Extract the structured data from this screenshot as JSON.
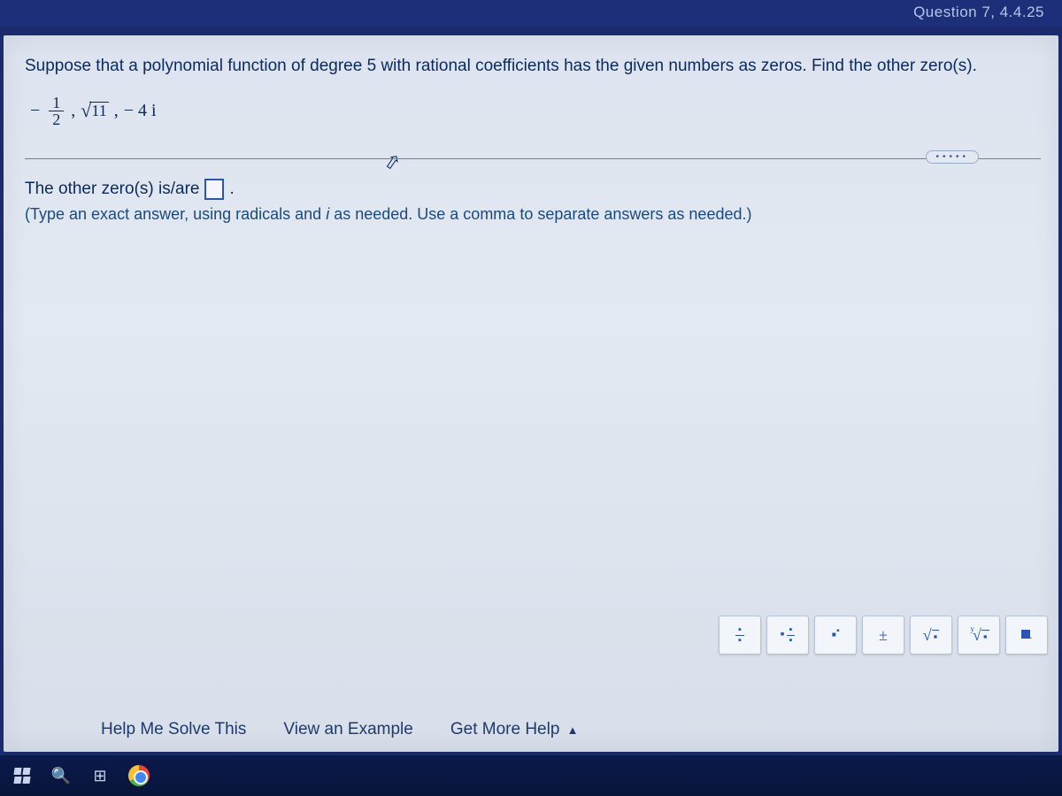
{
  "header": {
    "label": "Question 7, 4.4.25"
  },
  "prompt": "Suppose that a polynomial function of degree 5 with rational coefficients has the given numbers as zeros. Find the other zero(s).",
  "given_zeros": {
    "term_neg": "−",
    "frac_num": "1",
    "frac_den": "2",
    "comma1": ",",
    "sqrt_arg": "11",
    "comma2": ",",
    "term3": "− 4 i"
  },
  "divider_pill": "•••••",
  "answer": {
    "prefix": "The other zero(s) is/are",
    "suffix": "."
  },
  "hint": {
    "open": "(Type an exact answer, using radicals and ",
    "i": "i",
    "rest": " as needed. Use a comma to separate answers as needed.)"
  },
  "toolbar": {
    "frac": "frac",
    "mixed": "mixed",
    "exp": "exp",
    "pm": "±",
    "sqrt": "sqrt",
    "nroot": "nroot",
    "cube": "cube"
  },
  "help": {
    "solve": "Help Me Solve This",
    "example": "View an Example",
    "more": "Get More Help",
    "caret": "▲"
  }
}
